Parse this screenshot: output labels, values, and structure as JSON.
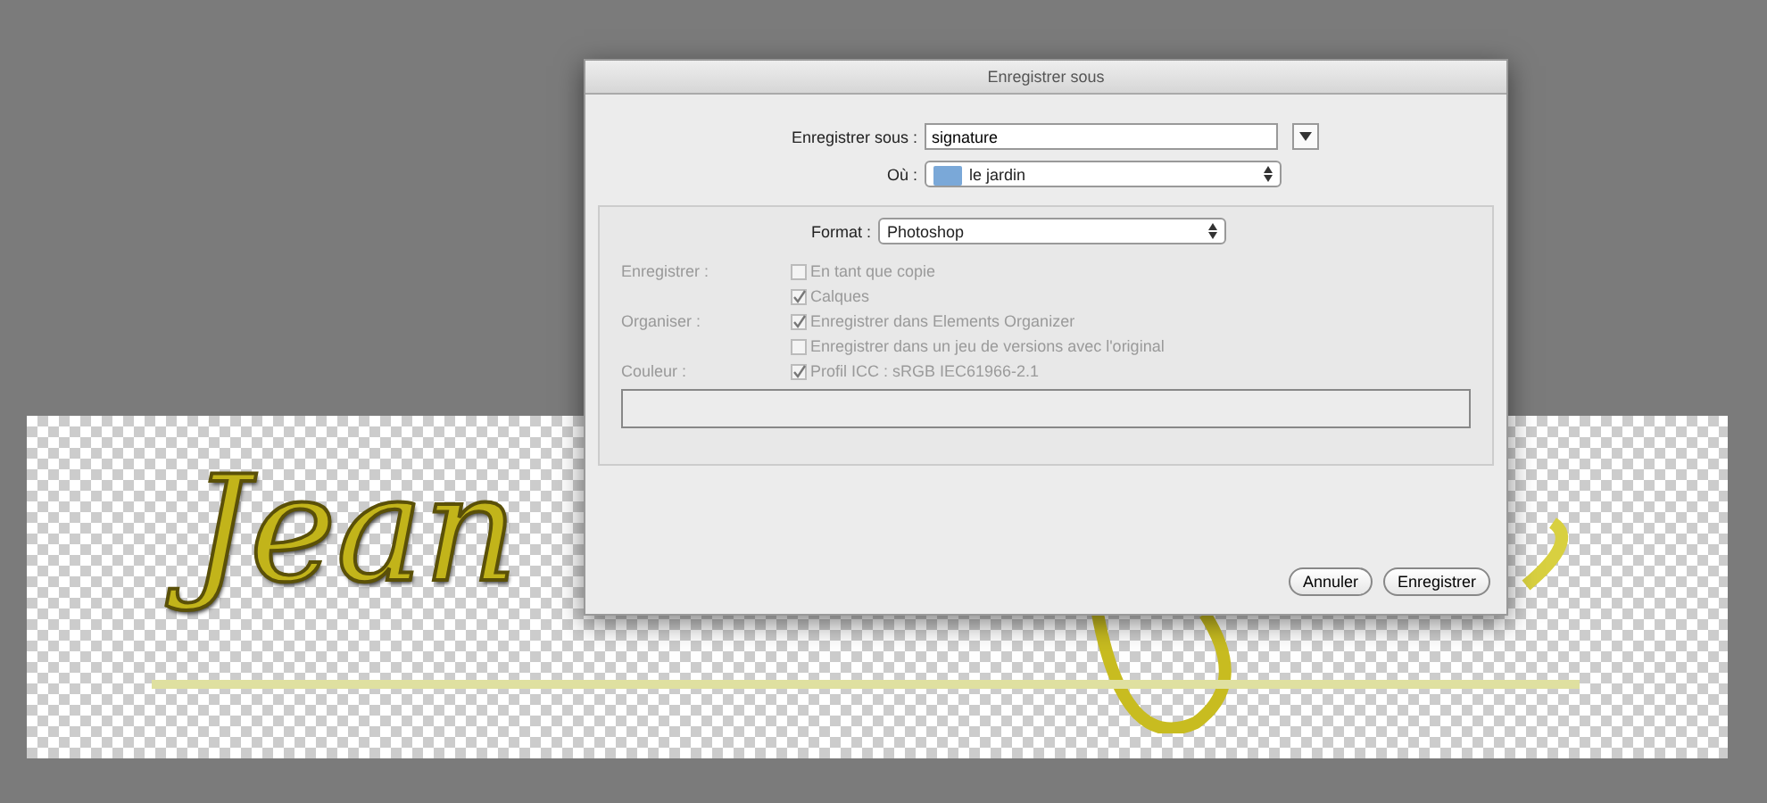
{
  "canvas": {
    "text": "Jean"
  },
  "dialog": {
    "title": "Enregistrer sous",
    "filename": {
      "label": "Enregistrer sous :",
      "value": "signature"
    },
    "location": {
      "label": "Où :",
      "value": "le jardin"
    },
    "format": {
      "label": "Format :",
      "value": "Photoshop"
    },
    "options": [
      {
        "group": "Enregistrer :",
        "label": "En tant que copie",
        "checked": false,
        "disabled": true
      },
      {
        "label": "Calques",
        "checked": true,
        "disabled": true
      },
      {
        "group": "Organiser :",
        "label": "Enregistrer dans Elements Organizer",
        "checked": true,
        "disabled": true
      },
      {
        "label": "Enregistrer dans un jeu de versions avec l'original",
        "checked": false,
        "disabled": true
      },
      {
        "group": "Couleur :",
        "label": "Profil ICC : sRGB IEC61966-2.1",
        "checked": true,
        "disabled": true
      }
    ],
    "buttons": [
      "Annuler",
      "Enregistrer"
    ]
  }
}
